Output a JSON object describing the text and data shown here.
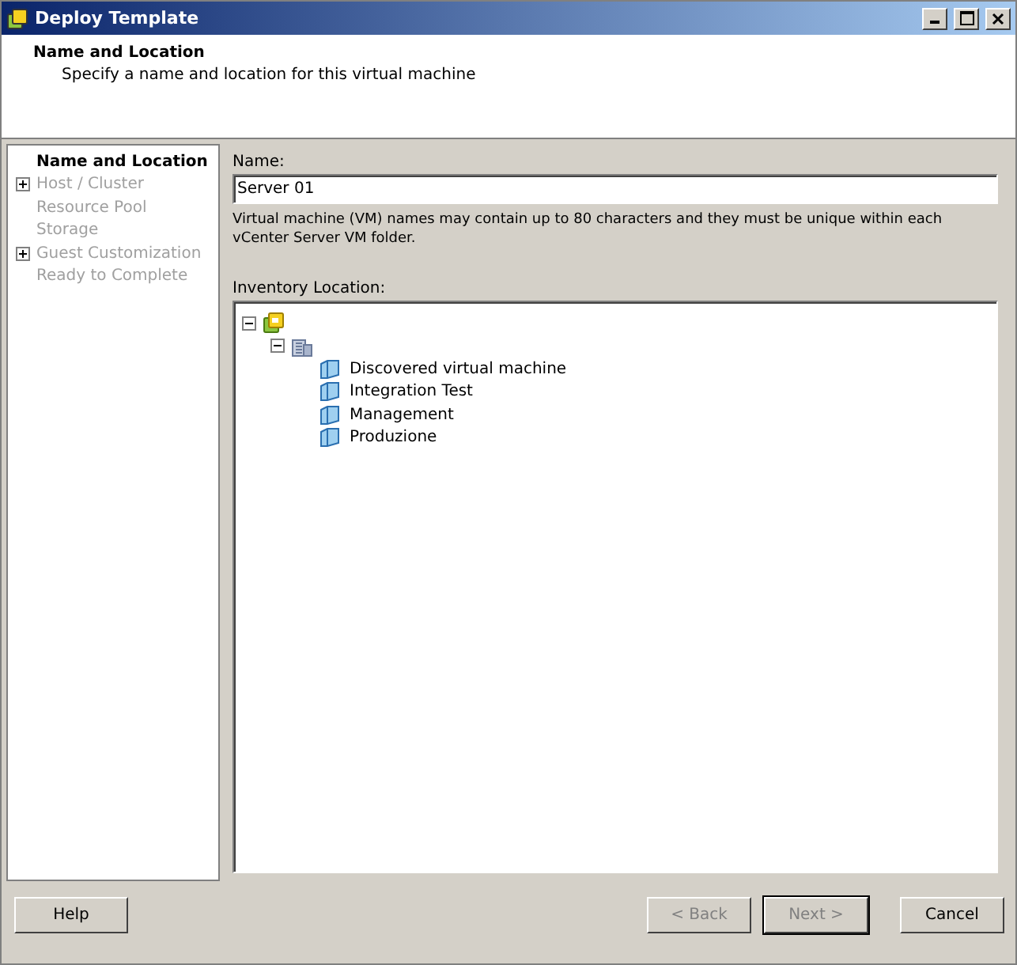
{
  "window": {
    "title": "Deploy Template"
  },
  "header": {
    "title": "Name and Location",
    "subtitle": "Specify a name and location for this virtual machine"
  },
  "steps": [
    {
      "label": "Name and Location",
      "selected": true,
      "disabled": false
    },
    {
      "label": "Host / Cluster",
      "selected": false,
      "disabled": true,
      "expanded": false
    },
    {
      "label": "Resource Pool",
      "selected": false,
      "disabled": true
    },
    {
      "label": "Storage",
      "selected": false,
      "disabled": true
    },
    {
      "label": "Guest Customization",
      "selected": false,
      "disabled": true,
      "expanded": false
    },
    {
      "label": "Ready to Complete",
      "selected": false,
      "disabled": true
    }
  ],
  "name_field": {
    "label": "Name:",
    "value": "Server 01"
  },
  "hint": "Virtual machine (VM) names may contain up to 80 characters and they must be unique within each vCenter Server VM folder.",
  "inventory": {
    "label": "Inventory Location:",
    "tree": [
      {
        "kind": "vcenter",
        "expanded": true,
        "children": [
          {
            "kind": "datacenter",
            "expanded": true,
            "children": [
              {
                "kind": "folder",
                "label": "Discovered virtual machine"
              },
              {
                "kind": "folder",
                "label": "Integration Test"
              },
              {
                "kind": "folder",
                "label": "Management"
              },
              {
                "kind": "folder",
                "label": "Produzione"
              }
            ]
          }
        ]
      }
    ]
  },
  "buttons": [
    {
      "label": "Help",
      "disabled": false,
      "default": false
    },
    {
      "label": "< Back",
      "disabled": true,
      "default": false
    },
    {
      "label": "Next >",
      "disabled": true,
      "default": true
    },
    {
      "label": "Cancel",
      "disabled": false,
      "default": false
    }
  ]
}
